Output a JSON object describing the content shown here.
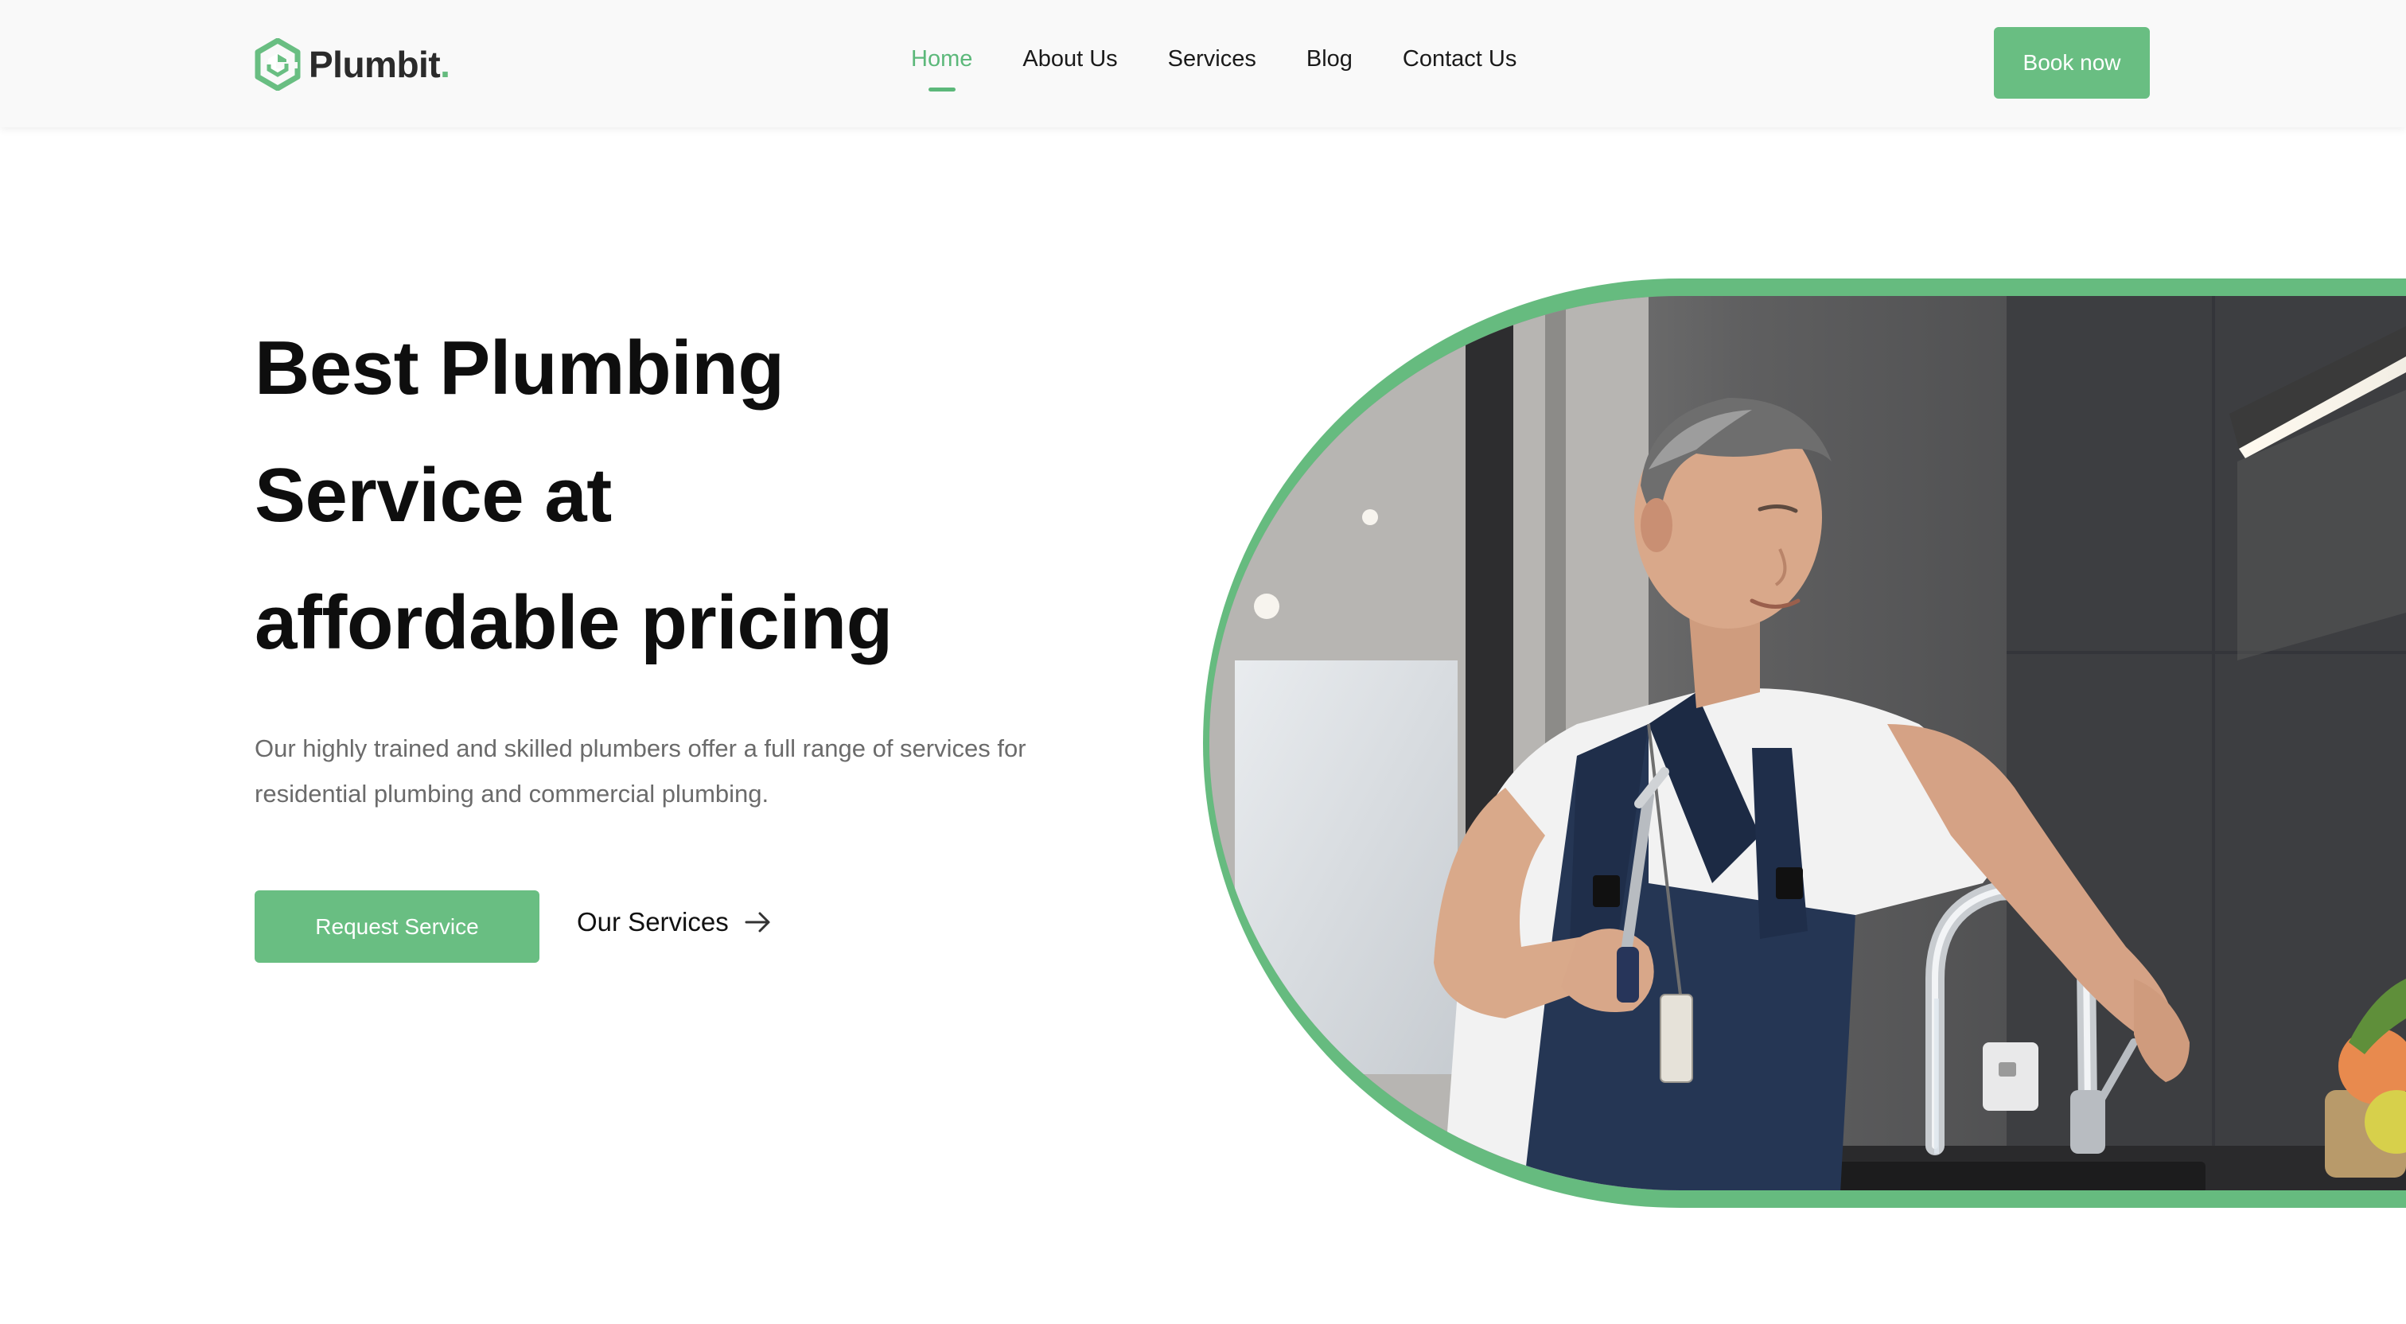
{
  "brand": {
    "name": "Plumbit",
    "dot": ".",
    "icon": "hexagon-wrench-logo-icon",
    "color": "#69be82"
  },
  "nav": {
    "items": [
      {
        "label": "Home",
        "active": true
      },
      {
        "label": "About Us",
        "active": false
      },
      {
        "label": "Services",
        "active": false
      },
      {
        "label": "Blog",
        "active": false
      },
      {
        "label": "Contact Us",
        "active": false
      }
    ],
    "cta": "Book now"
  },
  "hero": {
    "title_lines": [
      "Best Plumbing",
      "Service at",
      "affordable pricing"
    ],
    "description": "Our highly trained and skilled plumbers offer a full range of services for residential plumbing and commercial plumbing.",
    "primary_cta": "Request Service",
    "secondary_cta": "Our Services",
    "secondary_icon": "arrow-right-icon",
    "image_icon": "plumber-fixing-kitchen-faucet-photo"
  },
  "colors": {
    "accent": "#69be82",
    "nav_active": "#5cb87a",
    "text": "#111111",
    "muted": "#6b6b6b",
    "header_bg": "#f9f9f9"
  }
}
